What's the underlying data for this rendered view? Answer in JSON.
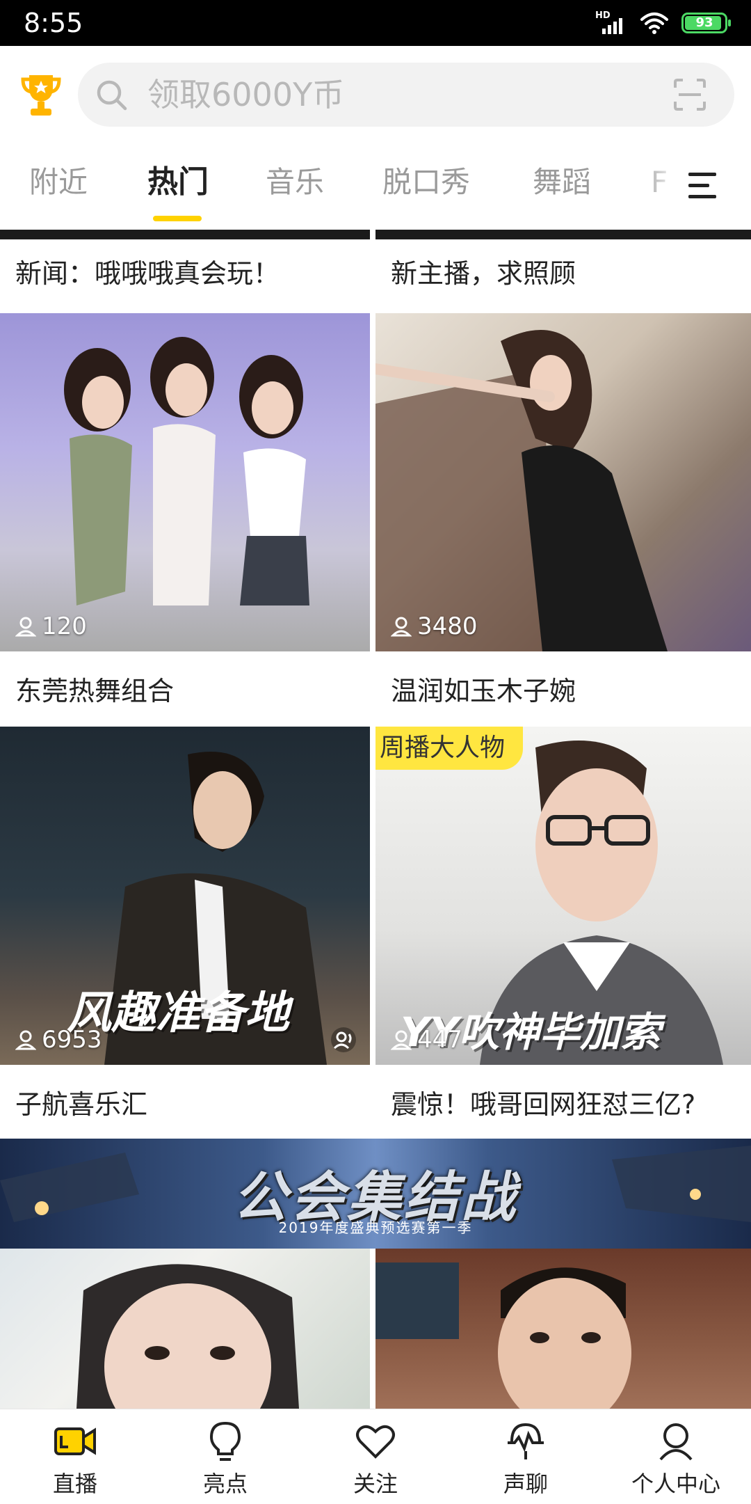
{
  "status_bar": {
    "time": "8:55",
    "network": "HD",
    "battery": "93",
    "battery_level_percent": 93
  },
  "search": {
    "placeholder": "领取6000Y币",
    "icon_left": "search-icon",
    "icon_right": "scan-icon"
  },
  "trophy_icon": "trophy-icon",
  "tabs": [
    {
      "label": "附近",
      "active": false
    },
    {
      "label": "热门",
      "active": true
    },
    {
      "label": "音乐",
      "active": false
    },
    {
      "label": "脱口秀",
      "active": false
    },
    {
      "label": "舞蹈",
      "active": false
    },
    {
      "label": "F",
      "active": false
    }
  ],
  "menu_icon": "menu-icon",
  "feed": {
    "top_row_titles": [
      "新闻：哦哦哦真会玩！",
      "新主播，求照顾"
    ],
    "cards": [
      {
        "title": "东莞热舞组合",
        "viewers": "120"
      },
      {
        "title": "温润如玉木子婉",
        "viewers": "3480"
      },
      {
        "title": "子航喜乐汇",
        "viewers": "6953",
        "caption": "风趣准备地"
      },
      {
        "title": "震惊！哦哥回网狂怼三亿?",
        "viewers": "447",
        "tag": "周播大人物",
        "caption": "YY吹神毕加索"
      }
    ],
    "banner": {
      "title": "公会集结战",
      "subtitle": "2019年度盛典预选赛第一季"
    }
  },
  "bottom_nav": [
    {
      "label": "直播",
      "icon": "live-camera-icon",
      "active": true
    },
    {
      "label": "亮点",
      "icon": "lightbulb-icon",
      "active": false
    },
    {
      "label": "关注",
      "icon": "heart-icon",
      "active": false
    },
    {
      "label": "声聊",
      "icon": "voice-chat-icon",
      "active": false
    },
    {
      "label": "个人中心",
      "icon": "profile-icon",
      "active": false
    }
  ],
  "colors": {
    "accent": "#ffd200",
    "battery": "#4cd964",
    "tag_bg": "#ffe640"
  }
}
